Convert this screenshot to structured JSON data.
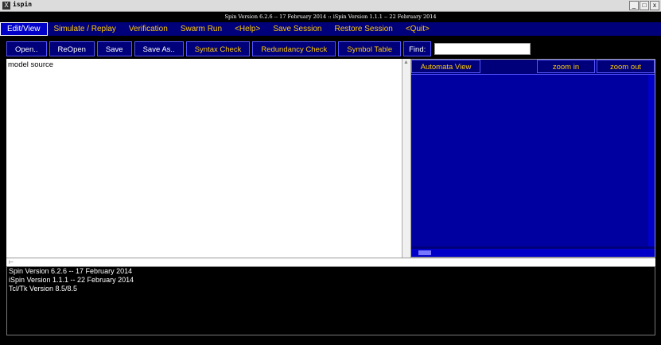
{
  "window": {
    "title": "ispin",
    "controls": [
      "_",
      "□",
      "x"
    ],
    "version_banner": "Spin Version 6.2.6 -- 17 February 2014 :: iSpin Version 1.1.1 -- 22 February 2014"
  },
  "menu": {
    "items": [
      {
        "label": "Edit/View"
      },
      {
        "label": "Simulate / Replay"
      },
      {
        "label": "Verification"
      },
      {
        "label": "Swarm Run"
      },
      {
        "label": "<Help>"
      },
      {
        "label": "Save Session"
      },
      {
        "label": "Restore Session"
      },
      {
        "label": "<Quit>"
      }
    ]
  },
  "toolbar": {
    "open": "Open..",
    "reopen": "ReOpen",
    "save": "Save",
    "save_as": "Save As..",
    "syntax_check": "Syntax Check",
    "redundancy_check": "Redundancy Check",
    "symbol_table": "Symbol Table",
    "find_label": "Find:",
    "find_value": ""
  },
  "editor": {
    "header": "model source"
  },
  "automata": {
    "view_label": "Automata View",
    "zoom_in": "zoom in",
    "zoom_out": "zoom out"
  },
  "log": {
    "lines": [
      "Spin Version 6.2.6 -- 17 February 2014",
      "iSpin Version 1.1.1 -- 22 February 2014",
      "Tcl/Tk Version 8.5/8.5"
    ]
  },
  "colors": {
    "menu_bg": "#00007a",
    "menu_text": "#ffcc00",
    "canvas_bg": "#0000a0",
    "log_bg": "#000000"
  }
}
